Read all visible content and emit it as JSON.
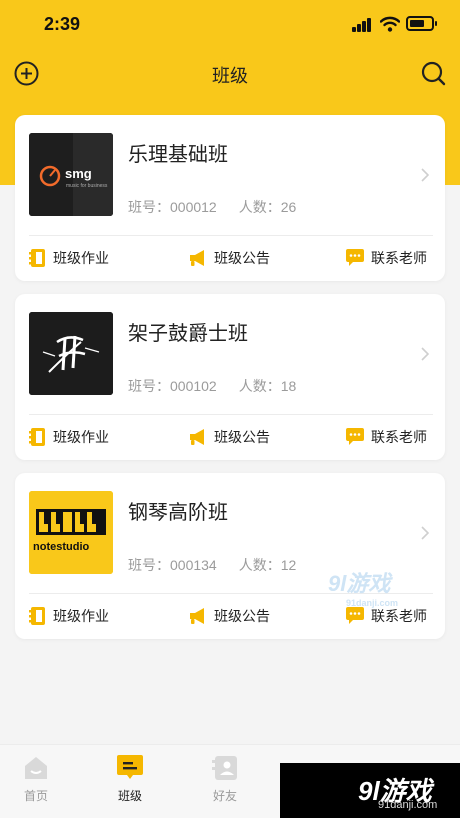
{
  "status_bar": {
    "time": "2:39"
  },
  "nav": {
    "title": "班级"
  },
  "meta_labels": {
    "class_no": "班号：",
    "members": "人数："
  },
  "actions": {
    "homework": "班级作业",
    "notice": "班级公告",
    "contact": "联系老师"
  },
  "classes": [
    {
      "name": "乐理基础班",
      "class_no": "000012",
      "members": "26",
      "thumb_brand": "smg",
      "thumb_tagline": "music for business"
    },
    {
      "name": "架子鼓爵士班",
      "class_no": "000102",
      "members": "18",
      "thumb_brand": "",
      "thumb_tagline": ""
    },
    {
      "name": "钢琴高阶班",
      "class_no": "000134",
      "members": "12",
      "thumb_brand": "notestudio",
      "thumb_tagline": ""
    }
  ],
  "tabs": [
    {
      "label": "首页",
      "icon": "home-icon",
      "active": false
    },
    {
      "label": "班级",
      "icon": "class-icon",
      "active": true
    },
    {
      "label": "好友",
      "icon": "contacts-icon",
      "active": false
    }
  ],
  "watermark": {
    "mid_text": "9l游戏",
    "mid_sub": "91danji.com",
    "box_text": "9l游戏",
    "box_sub": "91danji.com"
  },
  "colors": {
    "brand_yellow": "#f9c81a",
    "icon_yellow": "#f5b700",
    "background": "#f4f4f4"
  }
}
